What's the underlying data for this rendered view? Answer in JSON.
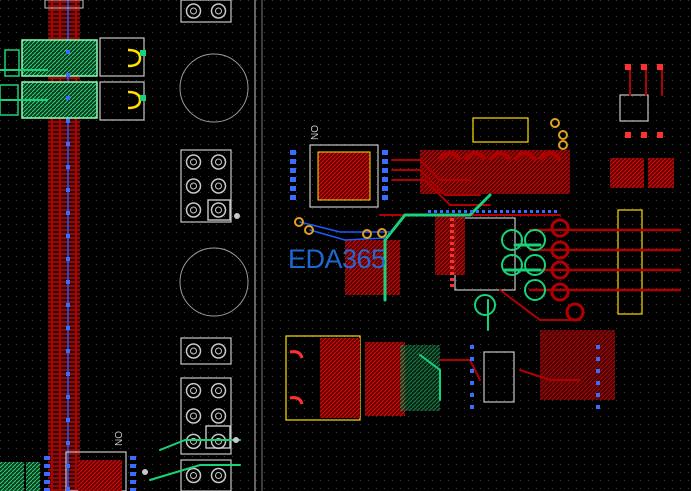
{
  "board": {
    "background": "#000000",
    "grid_color": "#3a3a3a",
    "colors": {
      "top_copper": "#b00000",
      "silkscreen": "#c8c8c8",
      "bottom_copper": "#1a5cff",
      "active_net": "#19d27a",
      "selected": "#8cffb4",
      "via": "#e0a020",
      "keepout": "#a07820",
      "pin_blue": "#3a6cff",
      "pin_red": "#ff3030"
    },
    "labels": {
      "no_top": "NO",
      "no_bottom": "NO"
    }
  },
  "watermark": {
    "text": "EDA365",
    "color": "#1f6fe0"
  }
}
